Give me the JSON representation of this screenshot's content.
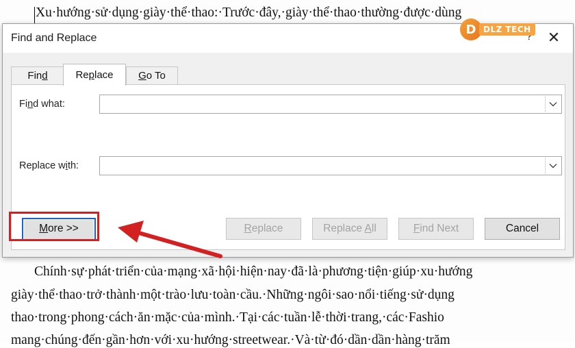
{
  "document": {
    "lines": [
      "Xu·hướng·sử·dụng·giày·thể·thao:·Trước·đây,·giày·thể·thao·thường·được·dùng",
      "Chính·sự·phát·triển·của·mạng·xã·hội·hiện·nay·đã·là·phương·tiện·giúp·xu·hướng",
      "giày·thể·thao·trở·thành·một·trào·lưu·toàn·cầu.·Những·ngôi·sao·nổi·tiếng·sử·dụng",
      "thao·trong·phong·cách·ăn·mặc·của·mình.·Tại·các·tuần·lễ·thời·trang,·các·Fashio",
      "mang·chúng·đến·gần·hơn·với·xu·hướng·streetwear.·Và·từ·đó·dần·dần·hàng·trăm"
    ]
  },
  "watermark": {
    "mark": "D",
    "text": "DLZ TECH"
  },
  "dialog": {
    "title": "Find and Replace",
    "help_glyph": "?",
    "close_glyph": "✕",
    "tabs": [
      {
        "pre": "Fin",
        "key": "d",
        "post": ""
      },
      {
        "pre": "Re",
        "key": "p",
        "post": "lace"
      },
      {
        "pre": "",
        "key": "G",
        "post": "o To"
      }
    ],
    "active_tab": "Replace",
    "find_label": {
      "pre": "Fi",
      "key": "n",
      "post": "d what:"
    },
    "find_value": "",
    "replace_label": {
      "pre": "Replace w",
      "key": "i",
      "post": "th:"
    },
    "replace_value": "",
    "buttons": {
      "more": {
        "pre": "",
        "key": "M",
        "post": "ore >>"
      },
      "replace": {
        "pre": "",
        "key": "R",
        "post": "eplace"
      },
      "replace_all": {
        "pre": "Replace ",
        "key": "A",
        "post": "ll"
      },
      "find_next": {
        "pre": "",
        "key": "F",
        "post": "ind Next"
      },
      "cancel": "Cancel"
    }
  },
  "colors": {
    "highlight": "#d32020",
    "accent": "#1a62c7"
  }
}
